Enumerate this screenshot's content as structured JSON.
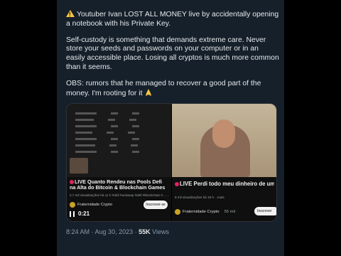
{
  "tweet": {
    "paragraphs": [
      "Youtuber Ivan LOST ALL MONEY live by accidentally opening a notebook with his Private Key.",
      "Self-custody is something that demands extreme care. Never store your seeds and passwords on your computer or in an easily accessible place. Losing all cryptos is much more common than it seems.",
      "OBS: rumors that he managed to recover a good part of the money. I'm rooting for it"
    ],
    "time": "8:24 AM",
    "date": "Aug 30, 2023",
    "views_count": "55K",
    "views_label": "Views"
  },
  "video_left": {
    "title": "LIVE Quanto Rendeu nas Pools Defi na Alta do Bitcoin  & Blockchain Games",
    "meta": "2,7 mil visualizações  há 11 h  #defi  #uniswap  #defi  #blockchain  #... ...mais",
    "channel": "Fraternidade Crypto",
    "subscribe": "Inscrever-se",
    "time": "0:21"
  },
  "video_right": {
    "title": "LIVE Perdi todo meu dinheiro de uma vez, por favor quem fez isso me chamar no",
    "meta": "8 mil visualizações  há 19 h  ...mais",
    "channel": "Fraternidade Crypto",
    "channel_count": "55 mil",
    "subscribe": "Inscrever"
  },
  "icons": {
    "warning": "warning-icon",
    "pray": "folded-hands-icon",
    "pause": "pause-icon"
  },
  "colors": {
    "background": "#15202b",
    "text": "#e7e9ea",
    "muted": "#8b98a5",
    "live": "#e0245e"
  }
}
